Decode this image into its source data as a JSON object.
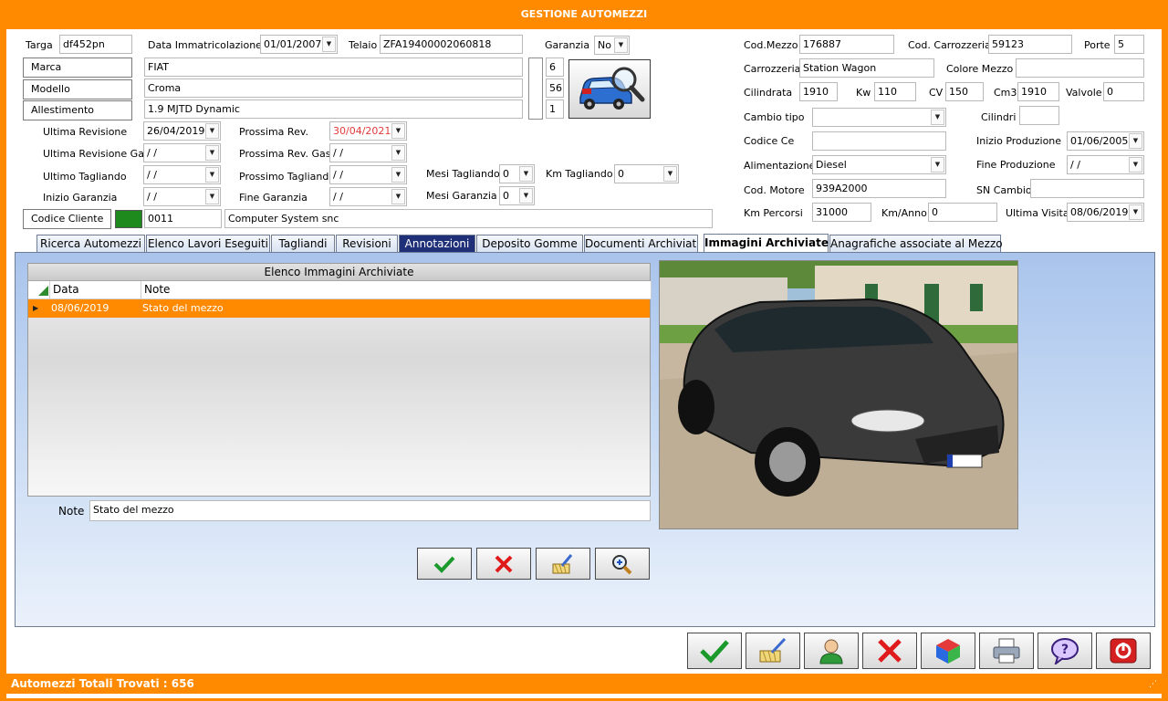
{
  "window": {
    "title": "GESTIONE AUTOMEZZI"
  },
  "vehicle": {
    "targa_label": "Targa",
    "targa": "df452pn",
    "data_imm_label": "Data Immatricolazione",
    "data_imm": "01/01/2007",
    "telaio_label": "Telaio",
    "telaio": "ZFA19400002060818",
    "garanzia_label": "Garanzia",
    "garanzia": "No",
    "marca_label": "Marca",
    "marca": "FIAT",
    "marca_code": "6",
    "modello_label": "Modello",
    "modello": "Croma",
    "modello_code": "56",
    "allestimento_label": "Allestimento",
    "allestimento": "1.9 MJTD Dynamic",
    "allestimento_code": "1",
    "ultima_rev_label": "Ultima Revisione",
    "ultima_rev": "26/04/2019",
    "prossima_rev_label": "Prossima Rev.",
    "prossima_rev": "30/04/2021",
    "ultima_rev_gas_label": "Ultima Revisione Gas",
    "ultima_rev_gas": " / /",
    "prossima_rev_gas_label": "Prossima Rev. Gas",
    "prossima_rev_gas": " / /",
    "ultimo_tagliando_label": "Ultimo Tagliando",
    "ultimo_tagliando": " / /",
    "prossimo_tagliando_label": "Prossimo Tagliando",
    "prossimo_tagliando": " / /",
    "mesi_tagliando_label": "Mesi Tagliando",
    "mesi_tagliando": "0",
    "km_tagliando_label": "Km Tagliando",
    "km_tagliando": "0",
    "inizio_garanzia_label": "Inizio Garanzia",
    "inizio_garanzia": " / /",
    "fine_garanzia_label": "Fine Garanzia",
    "fine_garanzia": " / /",
    "mesi_garanzia_label": "Mesi Garanzia",
    "mesi_garanzia": "0",
    "codice_cliente_label": "Codice Cliente",
    "codice_cliente": "0011",
    "cliente_nome": "Computer System snc"
  },
  "right": {
    "cod_mezzo_label": "Cod.Mezzo",
    "cod_mezzo": "176887",
    "cod_carrozzeria_label": "Cod. Carrozzeria",
    "cod_carrozzeria": "59123",
    "porte_label": "Porte",
    "porte": "5",
    "carrozzeria_label": "Carrozzeria",
    "carrozzeria": "Station Wagon",
    "colore_label": "Colore Mezzo",
    "colore": "",
    "cilindrata_label": "Cilindrata",
    "cilindrata": "1910",
    "kw_label": "Kw",
    "kw": "110",
    "cv_label": "CV",
    "cv": "150",
    "cm3_label": "Cm3",
    "cm3": "1910",
    "valvole_label": "Valvole",
    "valvole": "0",
    "cambio_tipo_label": "Cambio tipo",
    "cambio_tipo": "",
    "cilindri_label": "Cilindri",
    "cilindri": "",
    "codice_ce_label": "Codice Ce",
    "codice_ce": "",
    "inizio_prod_label": "Inizio Produzione",
    "inizio_prod": "01/06/2005",
    "alimentazione_label": "Alimentazione",
    "alimentazione": "Diesel",
    "fine_prod_label": "Fine Produzione",
    "fine_prod": " / /",
    "cod_motore_label": "Cod. Motore",
    "cod_motore": "939A2000",
    "sn_cambio_label": "SN Cambio",
    "sn_cambio": "",
    "km_percorsi_label": "Km Percorsi",
    "km_percorsi": "31000",
    "km_anno_label": "Km/Anno",
    "km_anno": "0",
    "ultima_visita_label": "Ultima Visita",
    "ultima_visita": "08/06/2019"
  },
  "tabs": [
    "Ricerca Automezzi",
    "Elenco Lavori Eseguiti",
    "Tagliandi",
    "Revisioni",
    "Annotazioni",
    "Deposito Gomme",
    "Documenti Archiviati",
    "Immagini Archiviate",
    "Anagrafiche associate al Mezzo"
  ],
  "images": {
    "caption": "Elenco Immagini Archiviate",
    "col_data": "Data",
    "col_note": "Note",
    "rows": [
      {
        "data": "08/06/2019",
        "note": "Stato del mezzo"
      }
    ],
    "note_label": "Note",
    "note_value": "Stato del mezzo"
  },
  "status": {
    "text": "Automezzi Totali Trovati : 656"
  },
  "colors": {
    "accent": "#ff8a00",
    "tab_active_bg": "#ffffff",
    "annotation_tab": "#1f2f78",
    "panel": "#c6d9f3"
  }
}
